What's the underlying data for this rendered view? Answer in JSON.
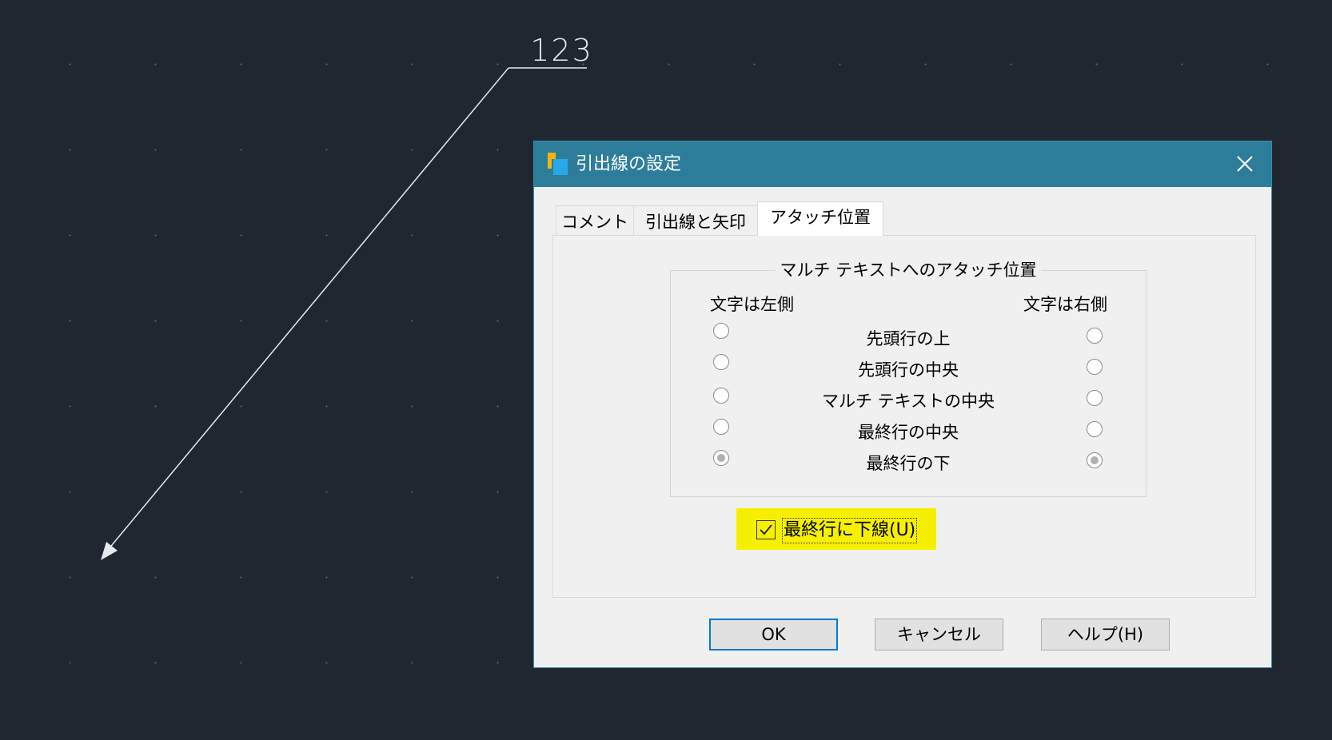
{
  "canvas": {
    "leader_label": "123"
  },
  "dialog": {
    "title": "引出線の設定",
    "tabs": [
      {
        "label": "コメント",
        "active": false
      },
      {
        "label": "引出線と矢印",
        "active": false
      },
      {
        "label": "アタッチ位置",
        "active": true
      }
    ],
    "group": {
      "title": "マルチ テキストへのアタッチ位置",
      "left_header": "文字は左側",
      "right_header": "文字は右側",
      "options": [
        {
          "label": "先頭行の上",
          "left_checked": false,
          "right_checked": false
        },
        {
          "label": "先頭行の中央",
          "left_checked": false,
          "right_checked": false
        },
        {
          "label": "マルチ テキストの中央",
          "left_checked": false,
          "right_checked": false
        },
        {
          "label": "最終行の中央",
          "left_checked": false,
          "right_checked": false
        },
        {
          "label": "最終行の下",
          "left_checked": true,
          "right_checked": true
        }
      ]
    },
    "underline_checkbox": {
      "label": "最終行に下線(U)",
      "checked": true,
      "highlight_color": "#f6f000"
    },
    "buttons": {
      "ok": "OK",
      "cancel": "キャンセル",
      "help": "ヘルプ(H)"
    }
  },
  "colors": {
    "canvas_bg": "#212731",
    "titlebar": "#2d7d9a",
    "dialog_bg": "#f0f0f0",
    "default_button_border": "#0078d7"
  },
  "icons": {
    "app": "app-icon",
    "close": "close-icon",
    "check": "check-icon",
    "arrow": "arrowhead-icon"
  }
}
